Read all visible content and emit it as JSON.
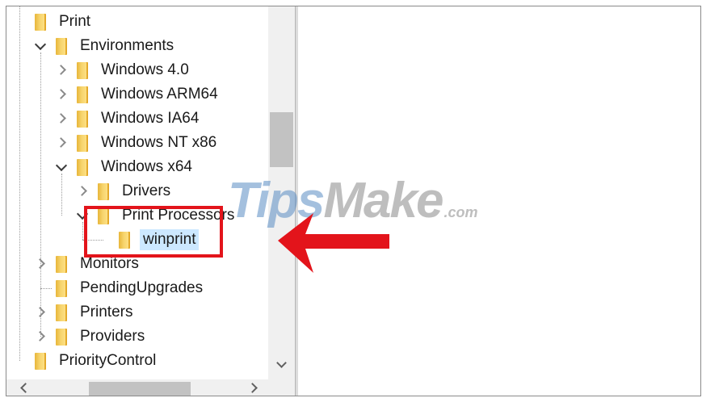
{
  "tree": {
    "nodes": [
      {
        "label": "Print",
        "level": 0,
        "chevron": "none",
        "selected": false
      },
      {
        "label": "Environments",
        "level": 1,
        "chevron": "down",
        "selected": false
      },
      {
        "label": "Windows 4.0",
        "level": 2,
        "chevron": "right",
        "selected": false
      },
      {
        "label": "Windows ARM64",
        "level": 2,
        "chevron": "right",
        "selected": false
      },
      {
        "label": "Windows IA64",
        "level": 2,
        "chevron": "right",
        "selected": false
      },
      {
        "label": "Windows NT x86",
        "level": 2,
        "chevron": "right",
        "selected": false
      },
      {
        "label": "Windows x64",
        "level": 2,
        "chevron": "down",
        "selected": false
      },
      {
        "label": "Drivers",
        "level": 3,
        "chevron": "right",
        "selected": false
      },
      {
        "label": "Print Processors",
        "level": 3,
        "chevron": "down",
        "selected": false
      },
      {
        "label": "winprint",
        "level": 4,
        "chevron": "none",
        "selected": true
      },
      {
        "label": "Monitors",
        "level": 1,
        "chevron": "right",
        "selected": false
      },
      {
        "label": "PendingUpgrades",
        "level": 1,
        "chevron": "none",
        "selected": false
      },
      {
        "label": "Printers",
        "level": 1,
        "chevron": "right",
        "selected": false
      },
      {
        "label": "Providers",
        "level": 1,
        "chevron": "right",
        "selected": false
      },
      {
        "label": "PriorityControl",
        "level": 0,
        "chevron": "none",
        "selected": false
      }
    ]
  },
  "watermark": {
    "part1": "Tips",
    "part2": "Make",
    "part3": ".com"
  },
  "colors": {
    "highlight": "#e3141b",
    "selection": "#cce8ff",
    "folder": "#f7d56e"
  },
  "icons": {
    "folder": "folder-icon",
    "expand": "chevron-right-icon",
    "collapse": "chevron-down-icon"
  }
}
